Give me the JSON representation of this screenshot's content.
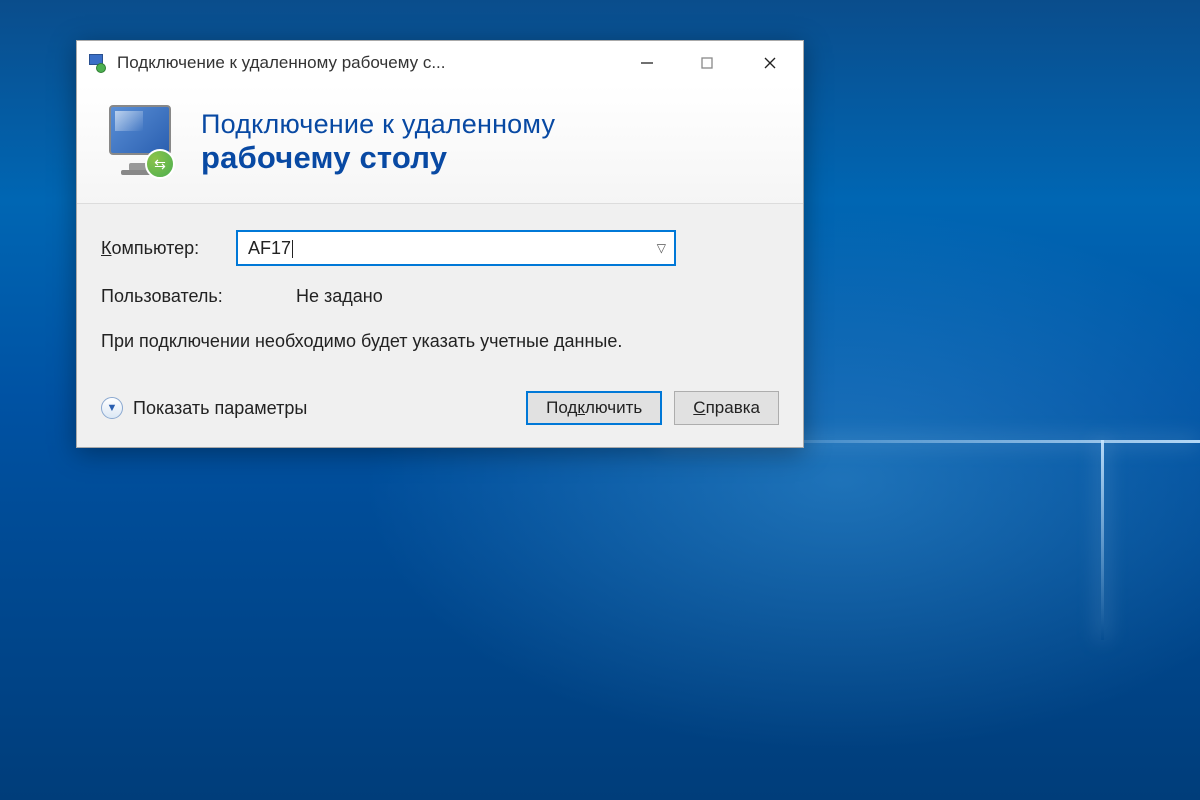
{
  "window": {
    "title": "Подключение к удаленному рабочему с..."
  },
  "header": {
    "line1": "Подключение к удаленному",
    "line2": "рабочему столу"
  },
  "form": {
    "computer_label": "Компьютер:",
    "computer_value": "AF17",
    "user_label": "Пользователь:",
    "user_value": "Не задано",
    "info_text": "При подключении необходимо будет указать учетные данные."
  },
  "footer": {
    "show_options": "Показать параметры",
    "connect": "Подключить",
    "help": "Справка"
  }
}
